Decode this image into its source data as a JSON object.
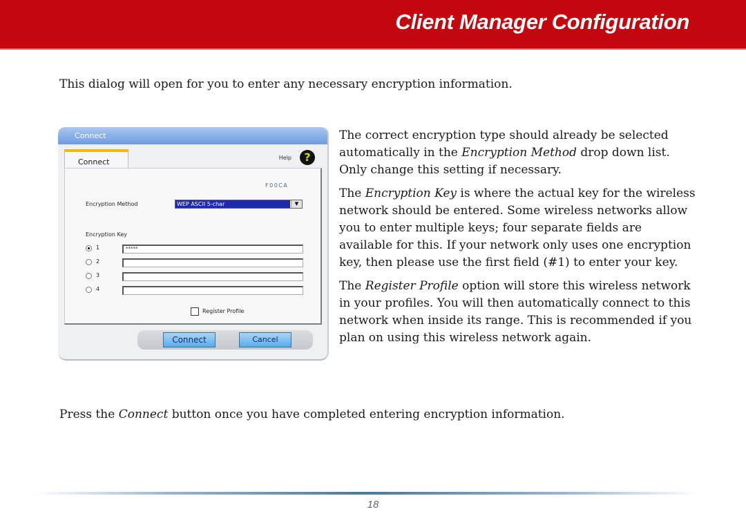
{
  "header": {
    "title": "Client Manager Configuration",
    "bg_color": "#c4070f"
  },
  "intro": "This dialog will open for you to enter any necessary encryption information.",
  "dialog": {
    "title": "Connect",
    "tab_label": "Connect",
    "help_label": "Help",
    "help_icon": "question-mark-icon",
    "ssid": "F00CA",
    "encryption_method_label": "Encryption Method",
    "encryption_method_value": "WEP ASCII 5-char",
    "encryption_key_label": "Encryption Key",
    "keys": [
      {
        "number": "1",
        "value": "*****",
        "selected": true
      },
      {
        "number": "2",
        "value": "",
        "selected": false
      },
      {
        "number": "3",
        "value": "",
        "selected": false
      },
      {
        "number": "4",
        "value": "",
        "selected": false
      }
    ],
    "register_profile_label": "Register Profile",
    "register_profile_checked": false,
    "connect_button": "Connect",
    "cancel_button": "Cancel"
  },
  "body": {
    "p1": {
      "a": "The correct encryption type should already be selected automatically in the ",
      "em": "Encryption Method",
      "b": " drop down list.  Only change this setting if necessary."
    },
    "p2": {
      "a": "The ",
      "em": "Encryption Key",
      "b": " is where the actual key for the wireless network should be entered.  Some wireless networks allow you to enter multiple keys; four separate fields are available for this.  If your network only uses one encryption key, then please use the first field (#1) to enter your key."
    },
    "p3": {
      "a": "The ",
      "em": "Register Profile",
      "b": " option will store this wireless network in your profiles.  You will then automatically connect to this network when inside its range.  This is recommended if you plan on using this wireless network again."
    }
  },
  "closing": {
    "a": "Press the ",
    "em": "Connect",
    "b": " button once you have completed entering encryption information."
  },
  "footer": {
    "page_number": "18"
  }
}
